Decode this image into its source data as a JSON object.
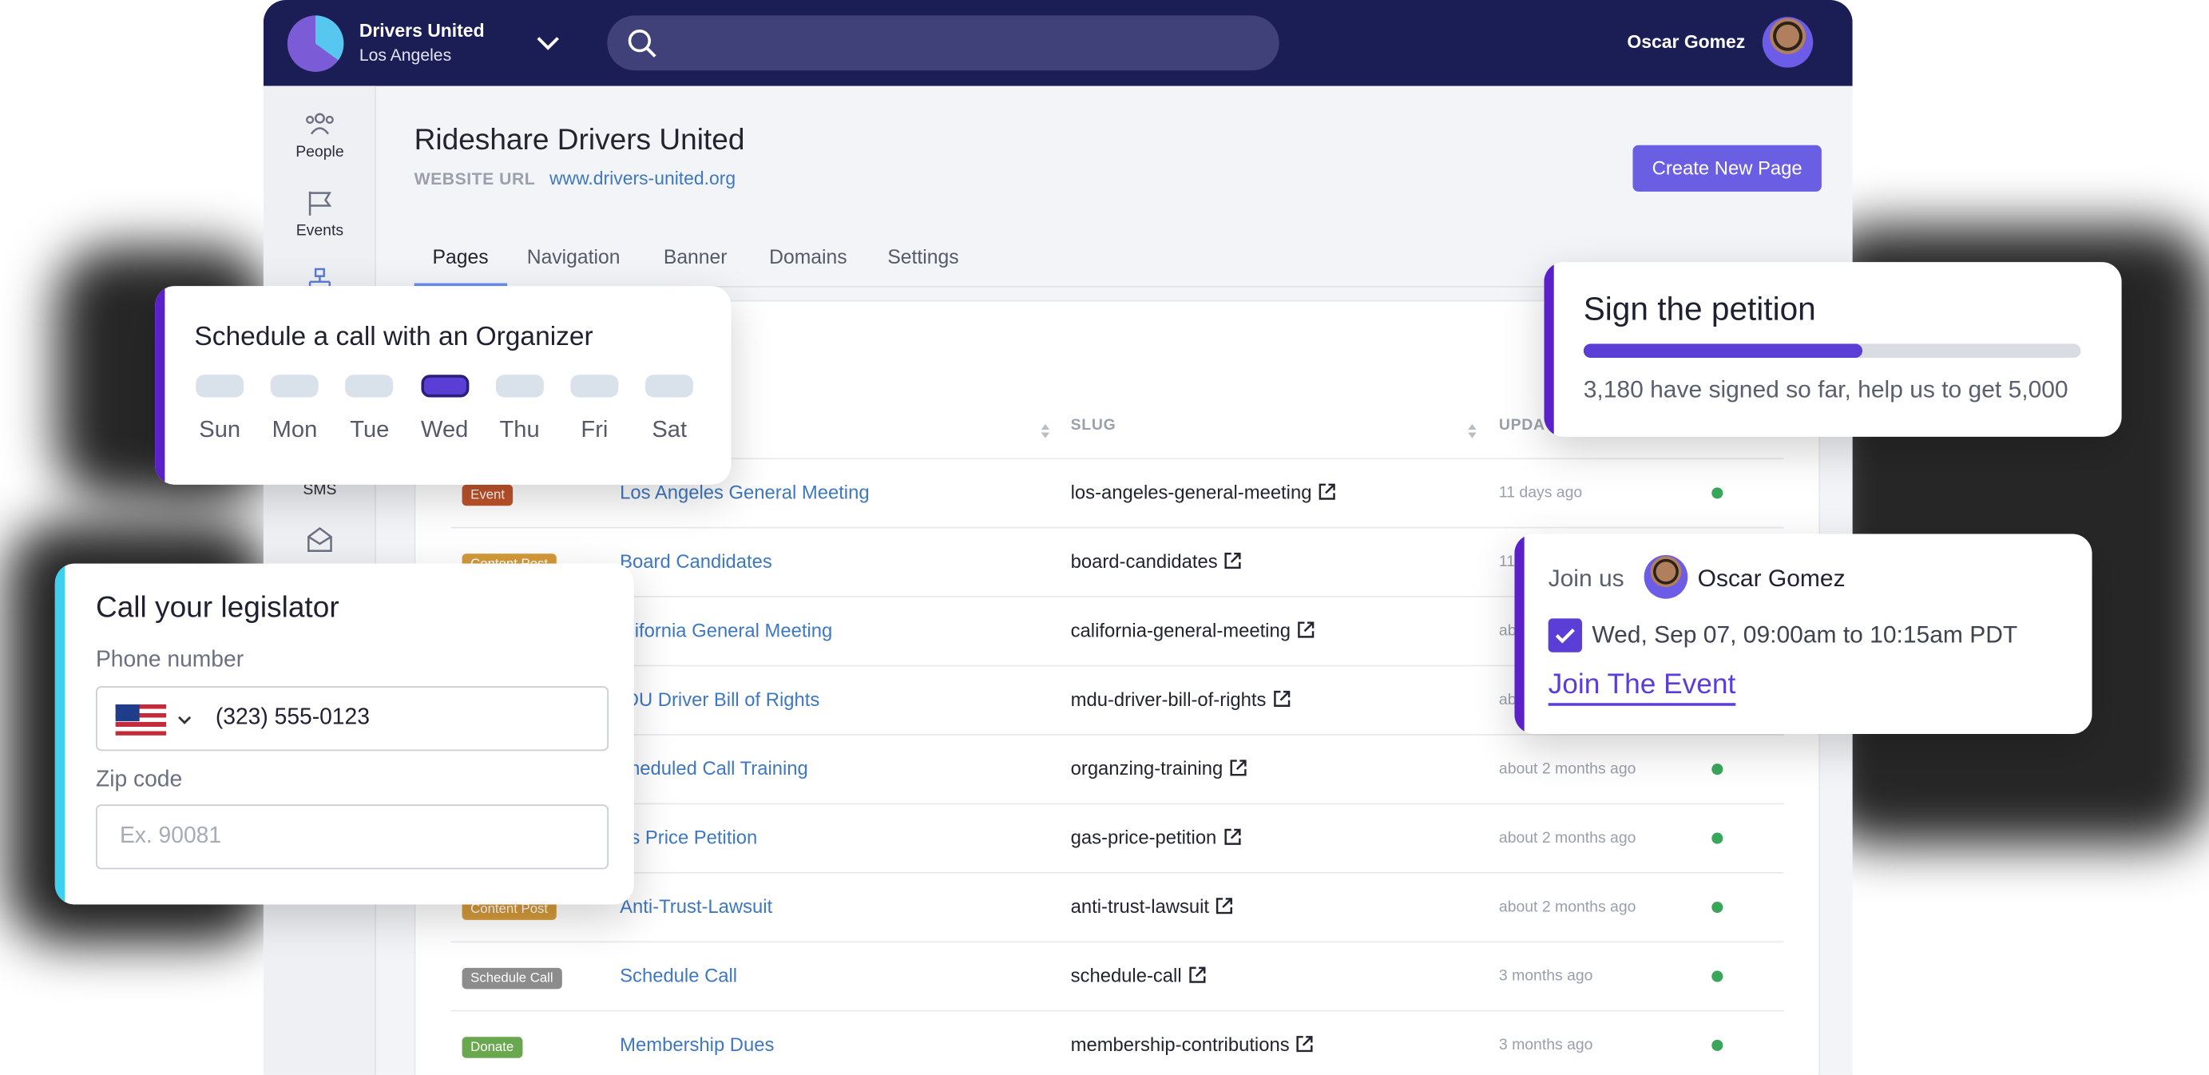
{
  "topbar": {
    "org_name": "Drivers United",
    "org_city": "Los Angeles",
    "user_name": "Oscar Gomez"
  },
  "sidebar": {
    "items": [
      {
        "label": "People",
        "icon": "people-icon"
      },
      {
        "label": "Events",
        "icon": "flag-icon"
      },
      {
        "label": "",
        "icon": "sitemap-icon"
      },
      {
        "label": "SMS",
        "icon": "sms-icon"
      },
      {
        "label": "",
        "icon": "mail-icon"
      }
    ]
  },
  "main": {
    "title": "Rideshare Drivers United",
    "url_label": "WEBSITE URL",
    "url": "www.drivers-united.org",
    "create_button": "Create New Page",
    "tabs": [
      "Pages",
      "Navigation",
      "Banner",
      "Domains",
      "Settings"
    ],
    "active_tab": "Pages"
  },
  "table": {
    "columns": {
      "slug": "SLUG",
      "updated": "UPDA"
    },
    "rows": [
      {
        "type": "Event",
        "badge_color": "#c0532b",
        "title": "Los Angeles General Meeting",
        "slug": "los-angeles-general-meeting",
        "updated": "11 days ago",
        "published": true
      },
      {
        "type": "Content Post",
        "badge_color": "#d49a3a",
        "title": "Board Candidates",
        "slug": "board-candidates",
        "updated": "11",
        "published": true
      },
      {
        "type": "",
        "badge_color": "#c0532b",
        "title": "alifornia General Meeting",
        "slug": "california-general-meeting",
        "updated": "ab",
        "published": true
      },
      {
        "type": "",
        "badge_color": "#d49a3a",
        "title": "IDU Driver Bill of Rights",
        "slug": "mdu-driver-bill-of-rights",
        "updated": "ab",
        "published": true
      },
      {
        "type": "",
        "badge_color": "#8c8c8c",
        "title": "cheduled Call Training",
        "slug": "organzing-training",
        "updated": "about 2 months ago",
        "published": true
      },
      {
        "type": "",
        "badge_color": "#6aa84f",
        "title": "as Price Petition",
        "slug": "gas-price-petition",
        "updated": "about 2 months ago",
        "published": true
      },
      {
        "type": "Content Post",
        "badge_color": "#d49a3a",
        "title": "Anti-Trust-Lawsuit",
        "slug": "anti-trust-lawsuit",
        "updated": "about 2 months ago",
        "published": true
      },
      {
        "type": "Schedule Call",
        "badge_color": "#8c8c8c",
        "title": "Schedule Call",
        "slug": "schedule-call",
        "updated": "3 months ago",
        "published": true
      },
      {
        "type": "Donate",
        "badge_color": "#6aa84f",
        "title": "Membership Dues",
        "slug": "membership-contributions",
        "updated": "3 months ago",
        "published": true
      }
    ]
  },
  "schedule_card": {
    "title": "Schedule a call with an Organizer",
    "days": [
      "Sun",
      "Mon",
      "Tue",
      "Wed",
      "Thu",
      "Fri",
      "Sat"
    ],
    "selected_day": "Wed",
    "accent": "#5a21c9"
  },
  "call_card": {
    "title": "Call your legislator",
    "phone_label": "Phone number",
    "phone_value": "(323) 555-0123",
    "zip_label": "Zip code",
    "zip_placeholder": "Ex. 90081",
    "accent": "#3dd0ef"
  },
  "petition_card": {
    "title": "Sign the petition",
    "signed": 3180,
    "goal": 5000,
    "progress": 0.56,
    "subtitle": "3,180 have signed so far, help us to get 5,000",
    "accent": "#5a21c9"
  },
  "event_card": {
    "join_label": "Join us",
    "host": "Oscar Gomez",
    "time": "Wed, Sep 07, 09:00am to 10:15am PDT",
    "checked": true,
    "link": "Join The Event",
    "accent": "#5a21c9"
  }
}
